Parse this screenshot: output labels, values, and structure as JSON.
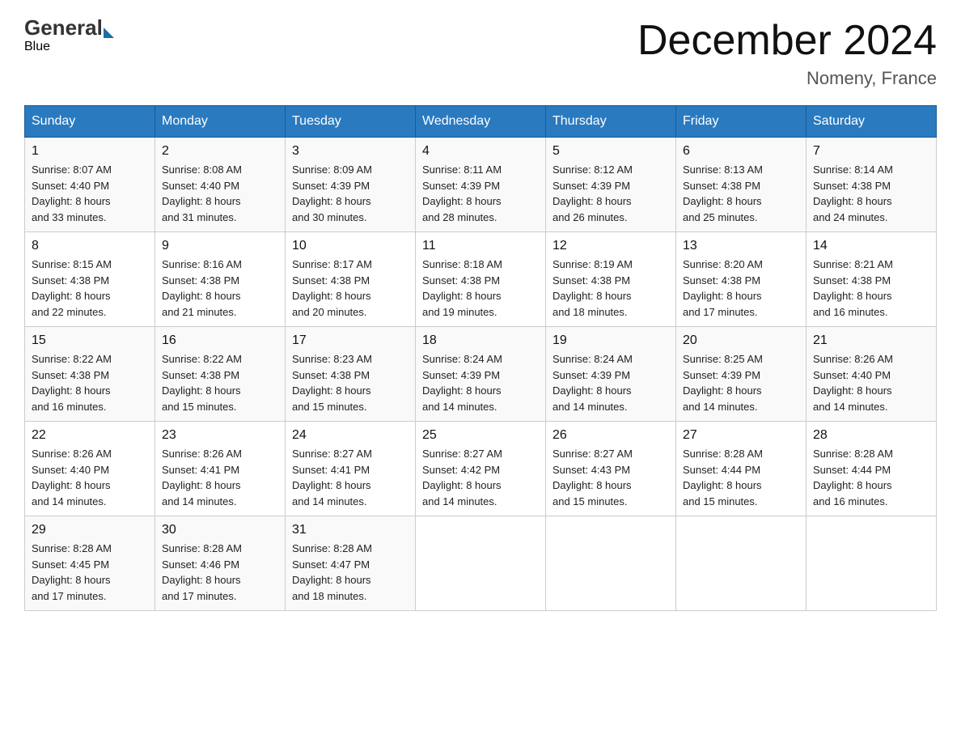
{
  "header": {
    "logo_general": "General",
    "logo_blue": "Blue",
    "month_title": "December 2024",
    "location": "Nomeny, France"
  },
  "days_of_week": [
    "Sunday",
    "Monday",
    "Tuesday",
    "Wednesday",
    "Thursday",
    "Friday",
    "Saturday"
  ],
  "weeks": [
    [
      {
        "day": "1",
        "sunrise": "8:07 AM",
        "sunset": "4:40 PM",
        "daylight": "8 hours and 33 minutes."
      },
      {
        "day": "2",
        "sunrise": "8:08 AM",
        "sunset": "4:40 PM",
        "daylight": "8 hours and 31 minutes."
      },
      {
        "day": "3",
        "sunrise": "8:09 AM",
        "sunset": "4:39 PM",
        "daylight": "8 hours and 30 minutes."
      },
      {
        "day": "4",
        "sunrise": "8:11 AM",
        "sunset": "4:39 PM",
        "daylight": "8 hours and 28 minutes."
      },
      {
        "day": "5",
        "sunrise": "8:12 AM",
        "sunset": "4:39 PM",
        "daylight": "8 hours and 26 minutes."
      },
      {
        "day": "6",
        "sunrise": "8:13 AM",
        "sunset": "4:38 PM",
        "daylight": "8 hours and 25 minutes."
      },
      {
        "day": "7",
        "sunrise": "8:14 AM",
        "sunset": "4:38 PM",
        "daylight": "8 hours and 24 minutes."
      }
    ],
    [
      {
        "day": "8",
        "sunrise": "8:15 AM",
        "sunset": "4:38 PM",
        "daylight": "8 hours and 22 minutes."
      },
      {
        "day": "9",
        "sunrise": "8:16 AM",
        "sunset": "4:38 PM",
        "daylight": "8 hours and 21 minutes."
      },
      {
        "day": "10",
        "sunrise": "8:17 AM",
        "sunset": "4:38 PM",
        "daylight": "8 hours and 20 minutes."
      },
      {
        "day": "11",
        "sunrise": "8:18 AM",
        "sunset": "4:38 PM",
        "daylight": "8 hours and 19 minutes."
      },
      {
        "day": "12",
        "sunrise": "8:19 AM",
        "sunset": "4:38 PM",
        "daylight": "8 hours and 18 minutes."
      },
      {
        "day": "13",
        "sunrise": "8:20 AM",
        "sunset": "4:38 PM",
        "daylight": "8 hours and 17 minutes."
      },
      {
        "day": "14",
        "sunrise": "8:21 AM",
        "sunset": "4:38 PM",
        "daylight": "8 hours and 16 minutes."
      }
    ],
    [
      {
        "day": "15",
        "sunrise": "8:22 AM",
        "sunset": "4:38 PM",
        "daylight": "8 hours and 16 minutes."
      },
      {
        "day": "16",
        "sunrise": "8:22 AM",
        "sunset": "4:38 PM",
        "daylight": "8 hours and 15 minutes."
      },
      {
        "day": "17",
        "sunrise": "8:23 AM",
        "sunset": "4:38 PM",
        "daylight": "8 hours and 15 minutes."
      },
      {
        "day": "18",
        "sunrise": "8:24 AM",
        "sunset": "4:39 PM",
        "daylight": "8 hours and 14 minutes."
      },
      {
        "day": "19",
        "sunrise": "8:24 AM",
        "sunset": "4:39 PM",
        "daylight": "8 hours and 14 minutes."
      },
      {
        "day": "20",
        "sunrise": "8:25 AM",
        "sunset": "4:39 PM",
        "daylight": "8 hours and 14 minutes."
      },
      {
        "day": "21",
        "sunrise": "8:26 AM",
        "sunset": "4:40 PM",
        "daylight": "8 hours and 14 minutes."
      }
    ],
    [
      {
        "day": "22",
        "sunrise": "8:26 AM",
        "sunset": "4:40 PM",
        "daylight": "8 hours and 14 minutes."
      },
      {
        "day": "23",
        "sunrise": "8:26 AM",
        "sunset": "4:41 PM",
        "daylight": "8 hours and 14 minutes."
      },
      {
        "day": "24",
        "sunrise": "8:27 AM",
        "sunset": "4:41 PM",
        "daylight": "8 hours and 14 minutes."
      },
      {
        "day": "25",
        "sunrise": "8:27 AM",
        "sunset": "4:42 PM",
        "daylight": "8 hours and 14 minutes."
      },
      {
        "day": "26",
        "sunrise": "8:27 AM",
        "sunset": "4:43 PM",
        "daylight": "8 hours and 15 minutes."
      },
      {
        "day": "27",
        "sunrise": "8:28 AM",
        "sunset": "4:44 PM",
        "daylight": "8 hours and 15 minutes."
      },
      {
        "day": "28",
        "sunrise": "8:28 AM",
        "sunset": "4:44 PM",
        "daylight": "8 hours and 16 minutes."
      }
    ],
    [
      {
        "day": "29",
        "sunrise": "8:28 AM",
        "sunset": "4:45 PM",
        "daylight": "8 hours and 17 minutes."
      },
      {
        "day": "30",
        "sunrise": "8:28 AM",
        "sunset": "4:46 PM",
        "daylight": "8 hours and 17 minutes."
      },
      {
        "day": "31",
        "sunrise": "8:28 AM",
        "sunset": "4:47 PM",
        "daylight": "8 hours and 18 minutes."
      },
      null,
      null,
      null,
      null
    ]
  ],
  "labels": {
    "sunrise": "Sunrise: ",
    "sunset": "Sunset: ",
    "daylight": "Daylight: "
  }
}
